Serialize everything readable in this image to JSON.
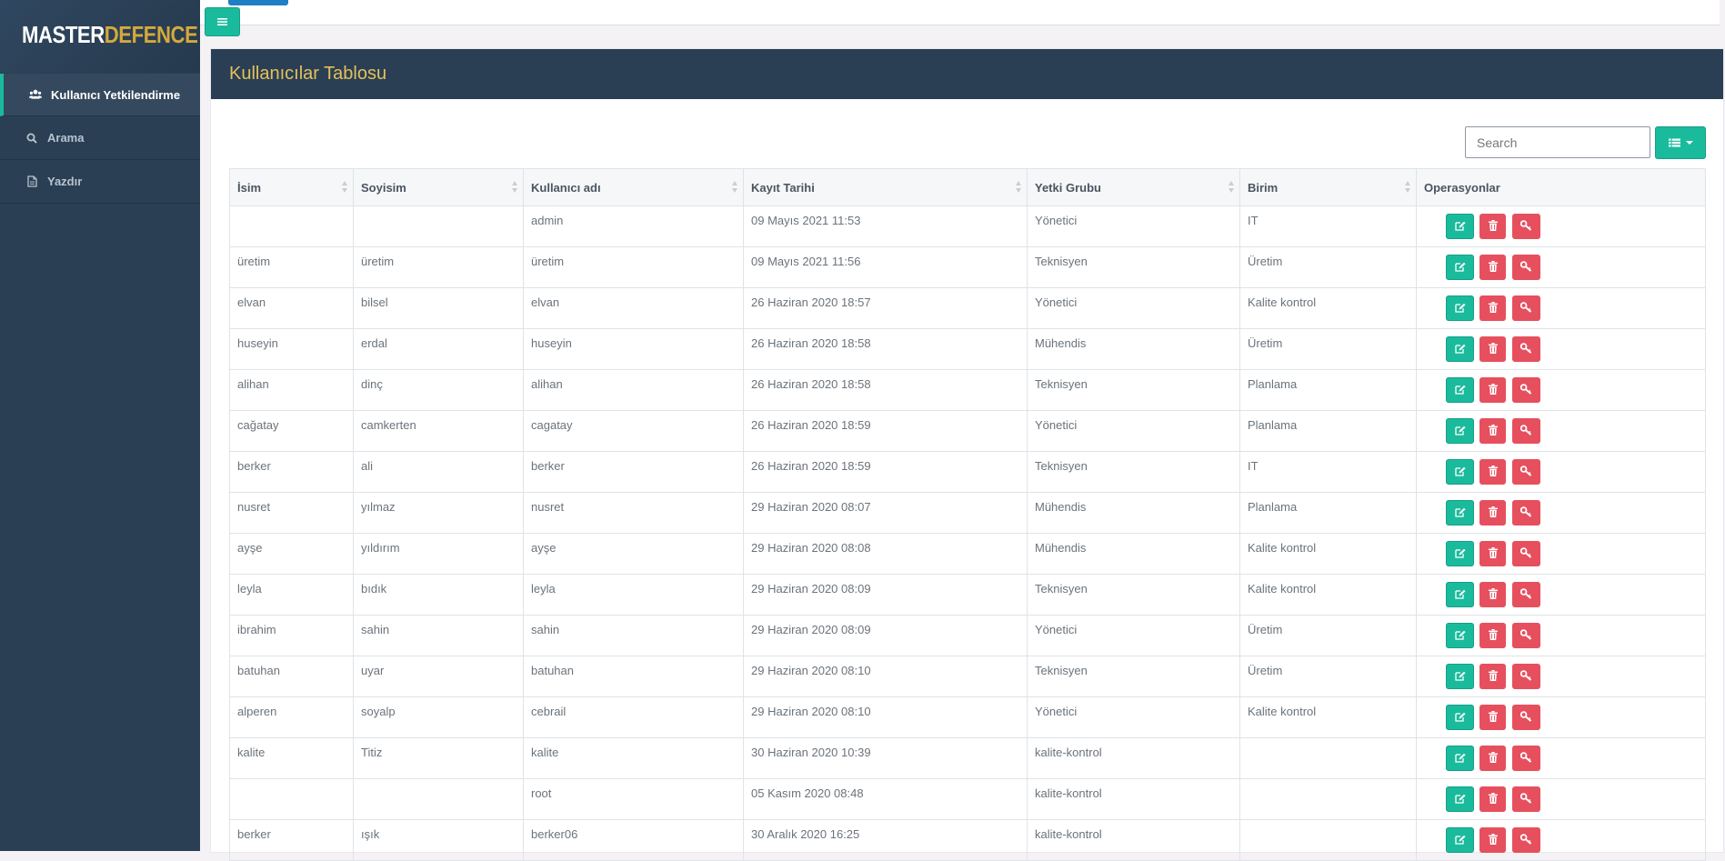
{
  "brand": {
    "part1": "MASTER",
    "part2": "DEFENCE"
  },
  "sidebar": {
    "items": [
      {
        "label": "Kullanıcı Yetkilendirme",
        "icon": "users-icon",
        "active": true
      },
      {
        "label": "Arama",
        "icon": "search-icon",
        "active": false
      },
      {
        "label": "Yazdır",
        "icon": "file-icon",
        "active": false
      }
    ]
  },
  "panel": {
    "title": "Kullanıcılar Tablosu"
  },
  "search": {
    "placeholder": "Search",
    "value": ""
  },
  "table": {
    "columns": [
      "İsim",
      "Soyisim",
      "Kullanıcı adı",
      "Kayıt Tarihi",
      "Yetki Grubu",
      "Birim",
      "Operasyonlar"
    ],
    "rows": [
      [
        "",
        "",
        "admin",
        "09 Mayıs 2021 11:53",
        "Yönetici",
        "IT"
      ],
      [
        "üretim",
        "üretim",
        "üretim",
        "09 Mayıs 2021 11:56",
        "Teknisyen",
        "Üretim"
      ],
      [
        "elvan",
        "bilsel",
        "elvan",
        "26 Haziran 2020 18:57",
        "Yönetici",
        "Kalite kontrol"
      ],
      [
        "huseyin",
        "erdal",
        "huseyin",
        "26 Haziran 2020 18:58",
        "Mühendis",
        "Üretim"
      ],
      [
        "alihan",
        "dinç",
        "alihan",
        "26 Haziran 2020 18:58",
        "Teknisyen",
        "Planlama"
      ],
      [
        "cağatay",
        "camkerten",
        "cagatay",
        "26 Haziran 2020 18:59",
        "Yönetici",
        "Planlama"
      ],
      [
        "berker",
        "ali",
        "berker",
        "26 Haziran 2020 18:59",
        "Teknisyen",
        "IT"
      ],
      [
        "nusret",
        "yılmaz",
        "nusret",
        "29 Haziran 2020 08:07",
        "Mühendis",
        "Planlama"
      ],
      [
        "ayşe",
        "yıldırım",
        "ayşe",
        "29 Haziran 2020 08:08",
        "Mühendis",
        "Kalite kontrol"
      ],
      [
        "leyla",
        "bıdık",
        "leyla",
        "29 Haziran 2020 08:09",
        "Teknisyen",
        "Kalite kontrol"
      ],
      [
        "ibrahim",
        "sahin",
        "sahin",
        "29 Haziran 2020 08:09",
        "Yönetici",
        "Üretim"
      ],
      [
        "batuhan",
        "uyar",
        "batuhan",
        "29 Haziran 2020 08:10",
        "Teknisyen",
        "Üretim"
      ],
      [
        "alperen",
        "soyalp",
        "cebrail",
        "29 Haziran 2020 08:10",
        "Yönetici",
        "Kalite kontrol"
      ],
      [
        "kalite",
        "Titiz",
        "kalite",
        "30 Haziran 2020 10:39",
        "kalite-kontrol",
        ""
      ],
      [
        "",
        "",
        "root",
        "05 Kasım 2020 08:48",
        "kalite-kontrol",
        ""
      ],
      [
        "berker",
        "ışık",
        "berker06",
        "30 Aralık 2020 16:25",
        "kalite-kontrol",
        ""
      ]
    ]
  },
  "icons": {
    "menu": "bars-icon",
    "columns": "list-icon",
    "edit": "edit-icon",
    "delete": "trash-icon",
    "key": "key-icon"
  },
  "colors": {
    "sidebar": "#2a3f54",
    "accent": "#1abb9c",
    "danger": "#e6505e",
    "title": "#e5c05a",
    "brand": "#d4a93c"
  }
}
